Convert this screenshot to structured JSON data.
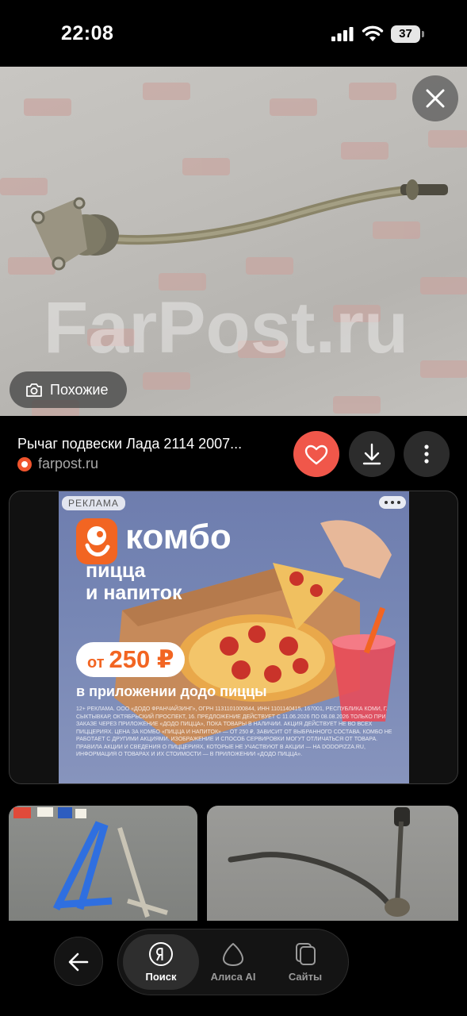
{
  "status_bar": {
    "time": "22:08",
    "battery_level": "37"
  },
  "image_viewer": {
    "watermark": "FarPost.ru",
    "similar_label": "Похожие",
    "close_icon": "close-icon"
  },
  "result": {
    "title": "Рычаг подвески Лада 2114 2007...",
    "source_domain": "farpost.ru",
    "like_icon": "heart-icon",
    "download_icon": "download-icon",
    "more_icon": "more-vertical-icon",
    "like_color": "#f0574a"
  },
  "ad": {
    "label": "РЕКЛАМА",
    "headline": "комбо",
    "subheadline_line1": "пицца",
    "subheadline_line2": "и напиток",
    "price_prefix": "от",
    "price": "250 ₽",
    "app_text": "в приложении додо пиццы",
    "legal": "12+ РЕКЛАМА. ООО «ДОДО ФРАНЧАЙЗИНГ», ОГРН 1131101000844, ИНН 1101140415, 167001, РЕСПУБЛИКА КОМИ, Г. СЫКТЫВКАР, ОКТЯБРЬСКИЙ ПРОСПЕКТ, 16. ПРЕДЛОЖЕНИЕ ДЕЙСТВУЕТ С 11.06.2026 ПО 08.08.2026 ТОЛЬКО ПРИ ЗАКАЗЕ ЧЕРЕЗ ПРИЛОЖЕНИЕ «ДОДО ПИЦЦА», ПОКА ТОВАРЫ В НАЛИЧИИ. АКЦИЯ ДЕЙСТВУЕТ НЕ ВО ВСЕХ ПИЦЦЕРИЯХ. ЦЕНА ЗА КОМБО «ПИЦЦА И НАПИТОК» — ОТ 250 ₽, ЗАВИСИТ ОТ ВЫБРАННОГО СОСТАВА. КОМБО НЕ РАБОТАЕТ С ДРУГИМИ АКЦИЯМИ. ИЗОБРАЖЕНИЕ И СПОСОБ СЕРВИРОВКИ МОГУТ ОТЛИЧАТЬСЯ ОТ ТОВАРА. ПРАВИЛА АКЦИИ И СВЕДЕНИЯ О ПИЦЦЕРИЯХ, КОТОРЫЕ НЕ УЧАСТВУЮТ В АКЦИИ — НА DODOPIZZA.RU, ИНФОРМАЦИЯ О ТОВАРАХ И ИХ СТОИМОСТИ — В ПРИЛОЖЕНИИ «ДОДО ПИЦЦА».",
    "brand_color": "#f26522"
  },
  "bottom_nav": {
    "back_icon": "arrow-left-icon",
    "tabs": [
      {
        "label": "Поиск",
        "icon": "yandex-search-icon",
        "active": true
      },
      {
        "label": "Алиса AI",
        "icon": "alice-icon",
        "active": false
      },
      {
        "label": "Сайты",
        "icon": "sites-icon",
        "active": false
      }
    ]
  }
}
